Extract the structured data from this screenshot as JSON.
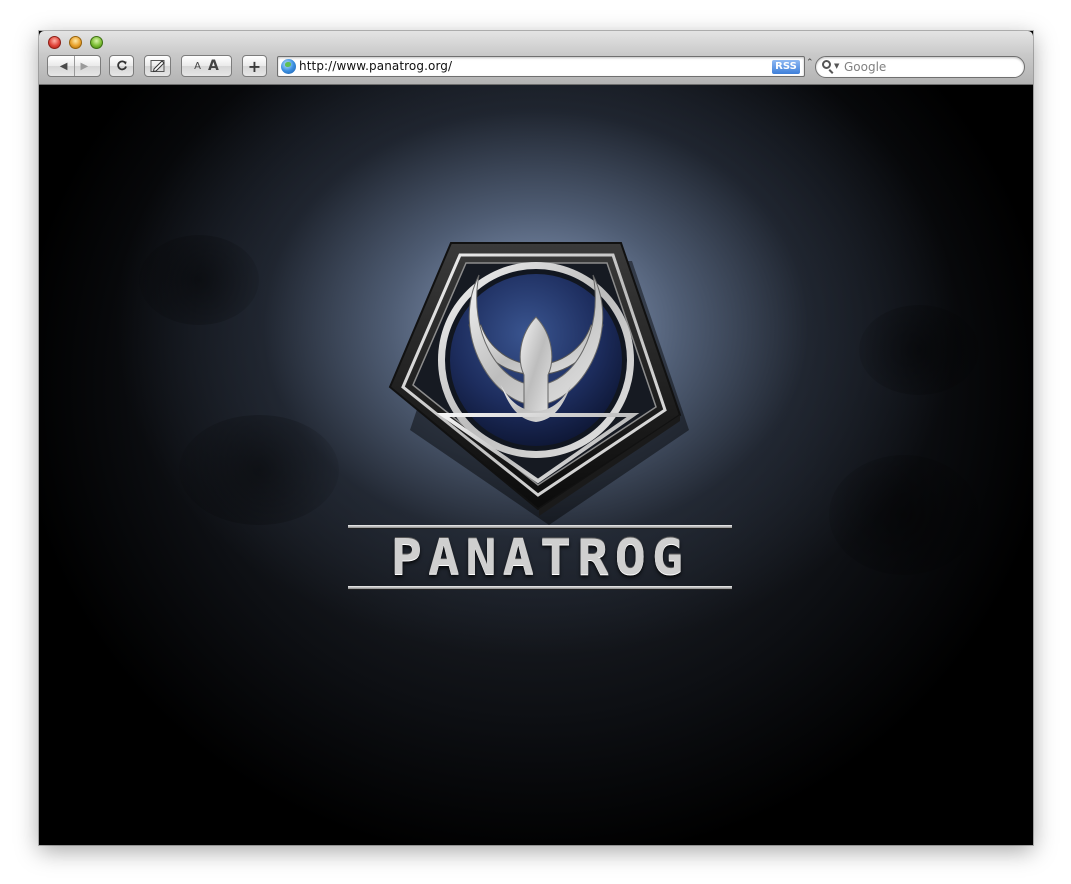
{
  "browser": {
    "url": "http://www.panatrog.org/",
    "rss_label": "RSS",
    "search_placeholder": "Google",
    "text_small_label": "A",
    "text_large_label": "A",
    "add_label": "+",
    "reload_label": "C",
    "url_dropdown": "⌃",
    "back_glyph": "◀",
    "forward_glyph": "▶"
  },
  "page": {
    "brand_name": "PANATROG",
    "accent_color": "#1d2d5e",
    "glow_color": "#96aacd"
  },
  "icons": {
    "close": "close-button-icon",
    "minimize": "minimize-button-icon",
    "zoom": "zoom-button-icon",
    "globe": "globe-icon",
    "search": "search-icon",
    "logo": "panatrog-emblem-icon"
  }
}
